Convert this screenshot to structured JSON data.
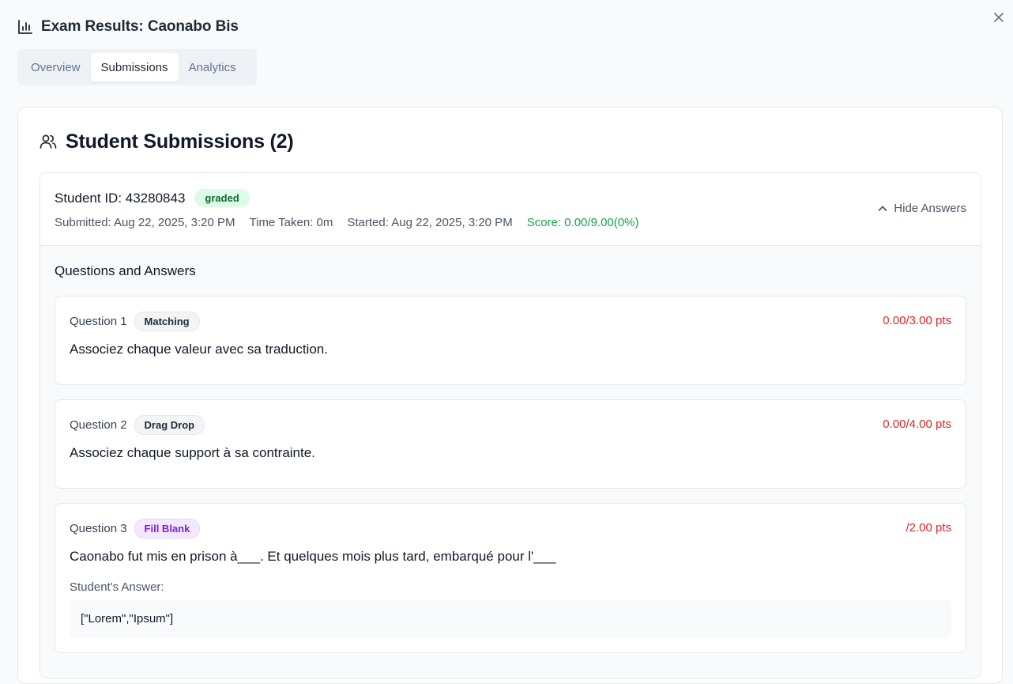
{
  "header": {
    "title": "Exam Results: Caonabo Bis",
    "icon": "bar-chart-icon"
  },
  "tabs": [
    {
      "label": "Overview",
      "active": false
    },
    {
      "label": "Submissions",
      "active": true
    },
    {
      "label": "Analytics",
      "active": false
    }
  ],
  "submissions_section": {
    "title": "Student Submissions (2)",
    "icon": "users-icon"
  },
  "submission": {
    "student_id": "Student ID: 43280843",
    "status": "graded",
    "submitted": "Submitted: Aug 22, 2025, 3:20 PM",
    "time_taken": "Time Taken: 0m",
    "started": "Started: Aug 22, 2025, 3:20 PM",
    "score": "Score: 0.00/9.00(0%)",
    "toggle_label": "Hide Answers",
    "qa_title": "Questions and Answers",
    "questions": [
      {
        "number": "Question 1",
        "type": "Matching",
        "points": "0.00/3.00 pts",
        "text": "Associez chaque valeur avec sa traduction."
      },
      {
        "number": "Question 2",
        "type": "Drag Drop",
        "points": "0.00/4.00 pts",
        "text": "Associez chaque support à sa contrainte."
      },
      {
        "number": "Question 3",
        "type": "Fill Blank",
        "points": "/2.00 pts",
        "text": "Caonabo fut mis en prison à___. Et quelques mois plus tard, embarqué pour l'___",
        "answer_label": "Student's Answer:",
        "answer": "[\"Lorem\",\"Ipsum\"]"
      }
    ]
  },
  "colors": {
    "success": "#16a34a",
    "danger": "#dc2626",
    "fill_badge": "#7e22ce"
  }
}
